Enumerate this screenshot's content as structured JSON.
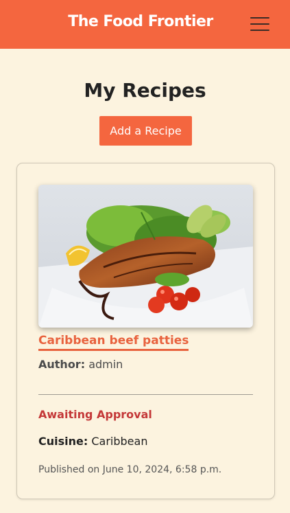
{
  "header": {
    "brand": "The Food Frontier",
    "menu_icon": "hamburger-menu-icon"
  },
  "main": {
    "title": "My Recipes",
    "add_button_label": "Add a Recipe"
  },
  "recipe": {
    "image_alt": "Caribbean beef patties",
    "title": "Caribbean beef patties",
    "author_label": "Author:",
    "author_value": "admin",
    "status": "Awaiting Approval",
    "cuisine_label": "Cuisine:",
    "cuisine_value": "Caribbean",
    "published": "Published on June 10, 2024, 6:58 p.m."
  },
  "colors": {
    "accent": "#f4663f",
    "background": "#fcf3df",
    "status_red": "#c43838"
  }
}
